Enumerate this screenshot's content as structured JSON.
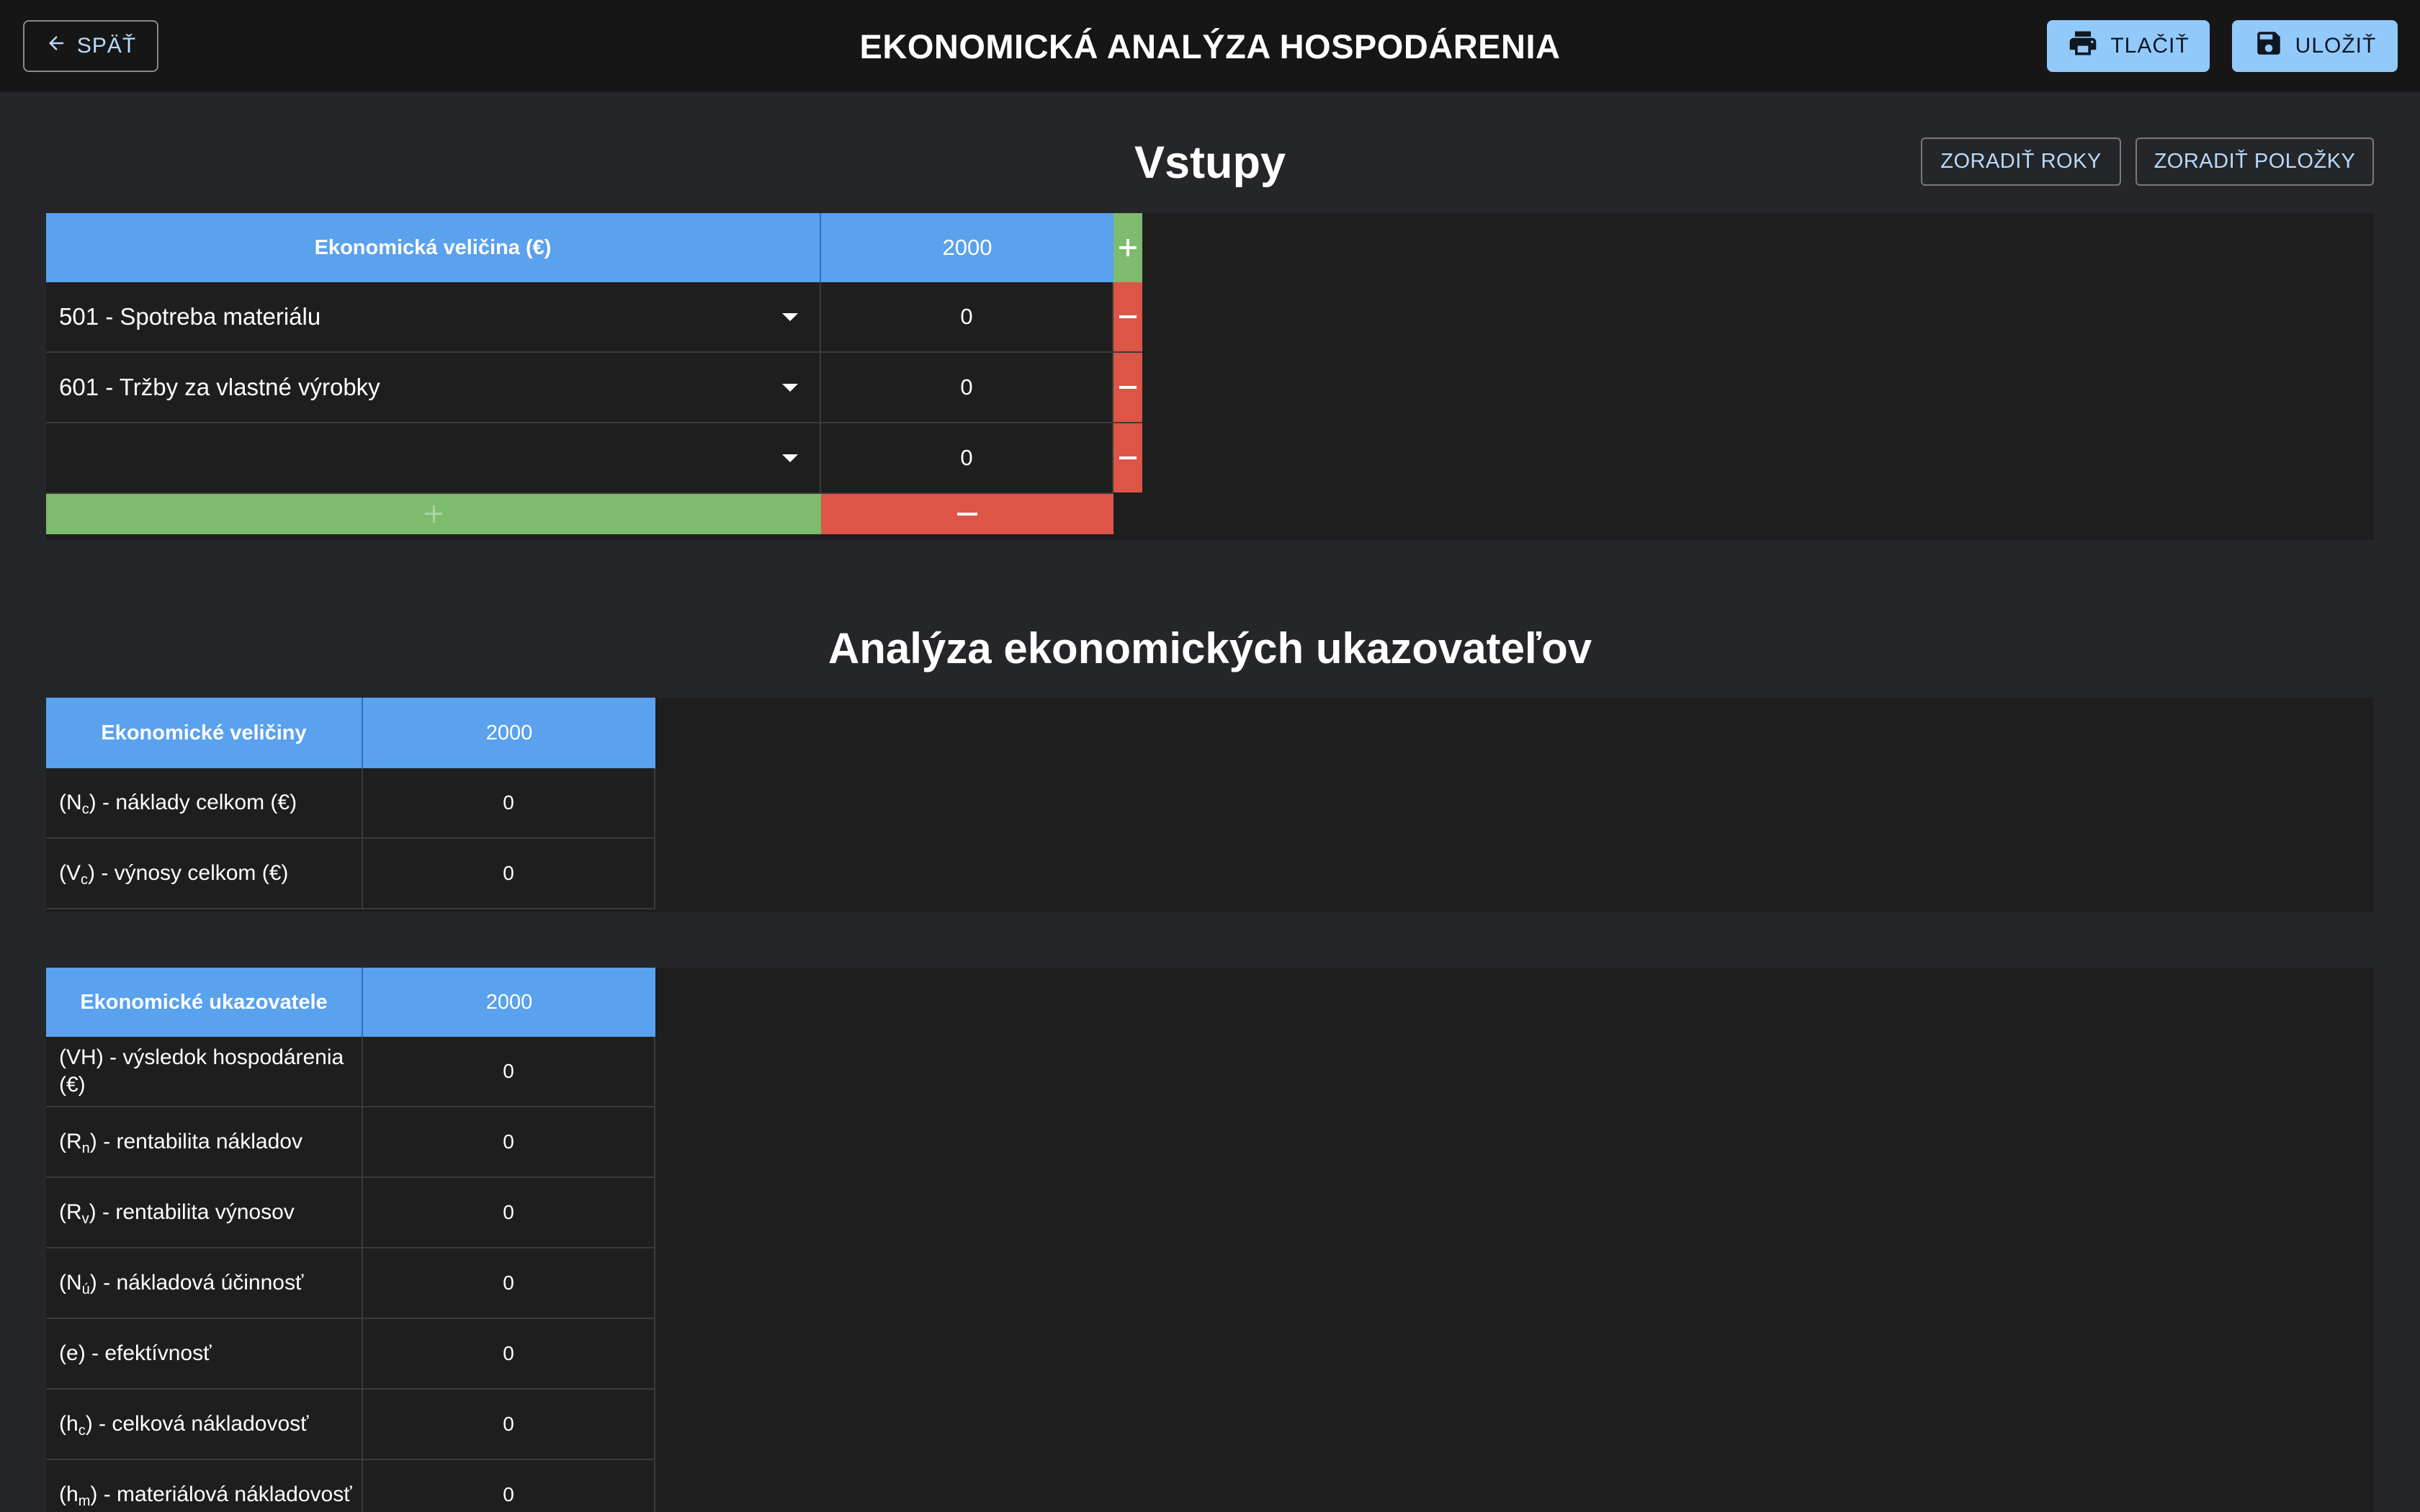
{
  "header": {
    "back_label": "SPÄŤ",
    "title": "EKONOMICKÁ ANALÝZA HOSPODÁRENIA",
    "print_label": "TLAČIŤ",
    "save_label": "ULOŽIŤ"
  },
  "inputs": {
    "title": "Vstupy",
    "sort_years_label": "ZORADIŤ ROKY",
    "sort_items_label": "ZORADIŤ POLOŽKY",
    "column_header": "Ekonomická veličina (€)",
    "year": "2000",
    "rows": [
      {
        "item": "501 - Spotreba materiálu",
        "value": "0"
      },
      {
        "item": "601 - Tržby za vlastné výrobky",
        "value": "0"
      },
      {
        "item": "",
        "value": "0"
      }
    ]
  },
  "analysis": {
    "title": "Analýza ekonomických ukazovateľov",
    "quantities": {
      "header": "Ekonomické veličiny",
      "year": "2000",
      "rows": [
        {
          "sym": "N",
          "sub": "c",
          "text": " - náklady celkom (€)",
          "value": "0"
        },
        {
          "sym": "V",
          "sub": "c",
          "text": " - výnosy celkom (€)",
          "value": "0"
        }
      ]
    },
    "indicators": {
      "header": "Ekonomické ukazovatele",
      "year": "2000",
      "rows": [
        {
          "sym": "VH",
          "sub": "",
          "text": " - výsledok hospodárenia (€)",
          "value": "0"
        },
        {
          "sym": "R",
          "sub": "n",
          "text": " - rentabilita nákladov",
          "value": "0"
        },
        {
          "sym": "R",
          "sub": "v",
          "text": " - rentabilita výnosov",
          "value": "0"
        },
        {
          "sym": "N",
          "sub": "ú",
          "text": " - nákladová účinnosť",
          "value": "0"
        },
        {
          "sym": "e",
          "sub": "",
          "text": " - efektívnosť",
          "value": "0"
        },
        {
          "sym": "h",
          "sub": "c",
          "text": " - celková nákladovosť",
          "value": "0"
        },
        {
          "sym": "h",
          "sub": "m",
          "text": " - materiálová nákladovosť",
          "value": "0"
        }
      ]
    }
  },
  "colors": {
    "header_blue": "#5aa1ee",
    "add_green": "#7dbb6e",
    "remove_red": "#dc5547",
    "primary_button": "#92c9fb",
    "background": "#252629"
  },
  "icons": {
    "back": "arrow-left-icon",
    "print": "printer-icon",
    "save": "floppy-disk-icon",
    "dropdown": "caret-down-icon",
    "add": "plus-icon",
    "remove": "minus-icon"
  }
}
